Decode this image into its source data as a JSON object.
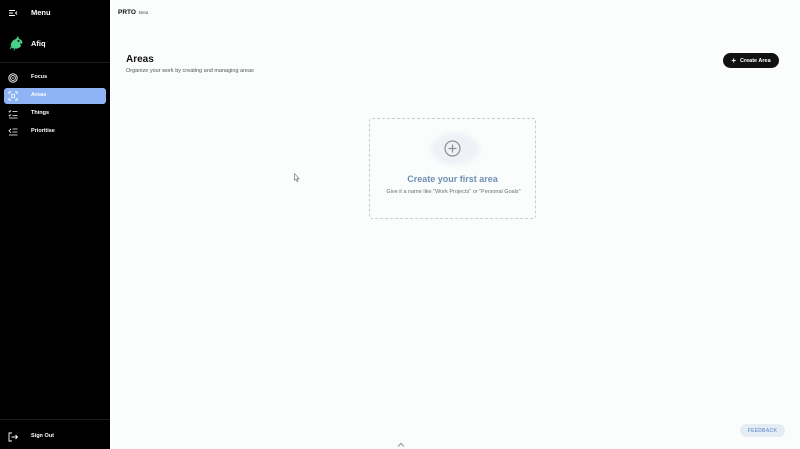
{
  "sidebar": {
    "menu_title": "Menu",
    "user_name": "Afiq",
    "items": [
      {
        "label": "Focus",
        "icon": "target-icon",
        "active": false
      },
      {
        "label": "Areas",
        "icon": "areas-icon",
        "active": true
      },
      {
        "label": "Things",
        "icon": "checklist-icon",
        "active": false
      },
      {
        "label": "Prioritise",
        "icon": "priority-list-icon",
        "active": false
      }
    ],
    "sign_out_label": "Sign Out"
  },
  "header": {
    "brand_name": "PRTO",
    "brand_tag": "Beta"
  },
  "main": {
    "title": "Areas",
    "subtitle": "Organize your work by creating and managing areas",
    "create_button_label": "Create Area",
    "empty_state": {
      "title": "Create your first area",
      "description": "Give it a name like \"Work Projects\" or \"Personal Goals\""
    }
  },
  "feedback_label": "FEEDBACK",
  "colors": {
    "sidebar_bg": "#000000",
    "active_item": "#8fb4f5",
    "primary_button": "#111111",
    "empty_title": "#6d8fb3",
    "feedback_bg": "#e6ecf4"
  }
}
